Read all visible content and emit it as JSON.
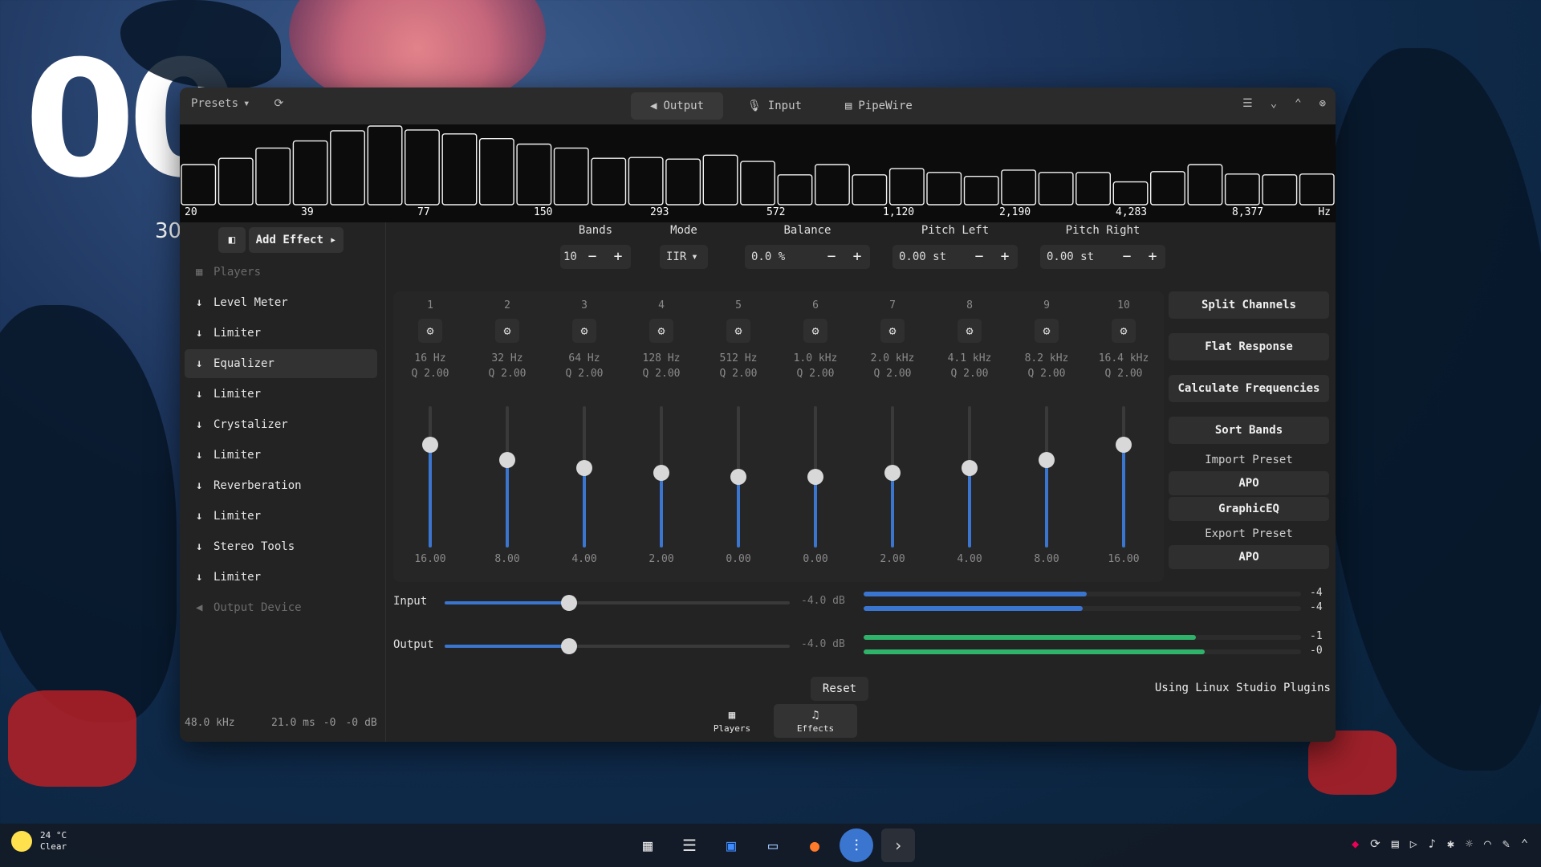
{
  "desktop": {
    "clock_partial": "00",
    "sub_partial": "30"
  },
  "window": {
    "presets_label": "Presets",
    "tabs": [
      {
        "label": "Output",
        "icon": "speaker-icon",
        "active": true
      },
      {
        "label": "Input",
        "icon": "microphone-icon",
        "active": false
      },
      {
        "label": "PipeWire",
        "icon": "pipewire-icon",
        "active": false
      }
    ]
  },
  "spectrum": {
    "labels": [
      "20",
      "39",
      "77",
      "150",
      "293",
      "572",
      "1,120",
      "2,190",
      "4,283",
      "8,377",
      "Hz"
    ],
    "levels": [
      0.51,
      0.59,
      0.72,
      0.81,
      0.94,
      1.0,
      0.95,
      0.9,
      0.84,
      0.77,
      0.72,
      0.59,
      0.6,
      0.58,
      0.63,
      0.55,
      0.38,
      0.51,
      0.38,
      0.46,
      0.41,
      0.36,
      0.44,
      0.41,
      0.41,
      0.29,
      0.42,
      0.51,
      0.39,
      0.38,
      0.39
    ]
  },
  "sidebar": {
    "add_effect_label": "Add Effect",
    "items": [
      {
        "label": "Players",
        "icon": "players-icon",
        "dim": true
      },
      {
        "label": "Level Meter",
        "icon": "arrow-down-icon"
      },
      {
        "label": "Limiter",
        "icon": "arrow-down-icon"
      },
      {
        "label": "Equalizer",
        "icon": "arrow-down-icon",
        "selected": true
      },
      {
        "label": "Limiter",
        "icon": "arrow-down-icon"
      },
      {
        "label": "Crystalizer",
        "icon": "arrow-down-icon"
      },
      {
        "label": "Limiter",
        "icon": "arrow-down-icon"
      },
      {
        "label": "Reverberation",
        "icon": "arrow-down-icon"
      },
      {
        "label": "Limiter",
        "icon": "arrow-down-icon"
      },
      {
        "label": "Stereo Tools",
        "icon": "arrow-down-icon"
      },
      {
        "label": "Limiter",
        "icon": "arrow-down-icon"
      },
      {
        "label": "Output Device",
        "icon": "speaker-icon",
        "dim": true
      }
    ],
    "status": {
      "rate": "48.0 kHz",
      "latency": "21.0 ms",
      "left": "-0",
      "right": "-0",
      "unit": "dB"
    }
  },
  "controls": {
    "bands": {
      "label": "Bands",
      "value": "10"
    },
    "mode": {
      "label": "Mode",
      "value": "IIR"
    },
    "balance": {
      "label": "Balance",
      "value": "0.0 %"
    },
    "pitch_left": {
      "label": "Pitch Left",
      "value": "0.00 st"
    },
    "pitch_right": {
      "label": "Pitch Right",
      "value": "0.00 st"
    }
  },
  "eq_bands": [
    {
      "num": "1",
      "freq": "16 Hz",
      "q": "Q 2.00",
      "gain": "16.00",
      "level": 0.73
    },
    {
      "num": "2",
      "freq": "32 Hz",
      "q": "Q 2.00",
      "gain": "8.00",
      "level": 0.62
    },
    {
      "num": "3",
      "freq": "64 Hz",
      "q": "Q 2.00",
      "gain": "4.00",
      "level": 0.56
    },
    {
      "num": "4",
      "freq": "128 Hz",
      "q": "Q 2.00",
      "gain": "2.00",
      "level": 0.53
    },
    {
      "num": "5",
      "freq": "512 Hz",
      "q": "Q 2.00",
      "gain": "0.00",
      "level": 0.5
    },
    {
      "num": "6",
      "freq": "1.0 kHz",
      "q": "Q 2.00",
      "gain": "0.00",
      "level": 0.5
    },
    {
      "num": "7",
      "freq": "2.0 kHz",
      "q": "Q 2.00",
      "gain": "2.00",
      "level": 0.53
    },
    {
      "num": "8",
      "freq": "4.1 kHz",
      "q": "Q 2.00",
      "gain": "4.00",
      "level": 0.56
    },
    {
      "num": "9",
      "freq": "8.2 kHz",
      "q": "Q 2.00",
      "gain": "8.00",
      "level": 0.62
    },
    {
      "num": "10",
      "freq": "16.4 kHz",
      "q": "Q 2.00",
      "gain": "16.00",
      "level": 0.73
    }
  ],
  "right_panel": {
    "split_channels": "Split Channels",
    "flat_response": "Flat Response",
    "calculate_frequencies": "Calculate Frequencies",
    "sort_bands": "Sort Bands",
    "import_preset": "Import Preset",
    "import_apo": "APO",
    "import_graphiceq": "GraphicEQ",
    "export_preset": "Export Preset",
    "export_apo": "APO"
  },
  "gain": {
    "input": {
      "label": "Input",
      "value": "-4.0 dB",
      "slider": 0.36,
      "meter_l": 0.51,
      "meter_r": 0.5,
      "val_l": "-4",
      "val_r": "-4"
    },
    "output": {
      "label": "Output",
      "value": "-4.0 dB",
      "slider": 0.36,
      "meter_l": 0.76,
      "meter_r": 0.78,
      "val_l": "-1",
      "val_r": "-0"
    }
  },
  "footer": {
    "reset_label": "Reset",
    "using_label": "Using Linux Studio Plugins",
    "tabs": [
      {
        "label": "Players",
        "icon": "players-icon",
        "active": false
      },
      {
        "label": "Effects",
        "icon": "music-note-icon",
        "active": true
      }
    ]
  },
  "taskbar": {
    "temperature": "24 °C",
    "condition": "Clear"
  },
  "colors": {
    "accent": "#3a75d0",
    "meter_green": "#2fb36b",
    "window_bg": "#232323"
  }
}
